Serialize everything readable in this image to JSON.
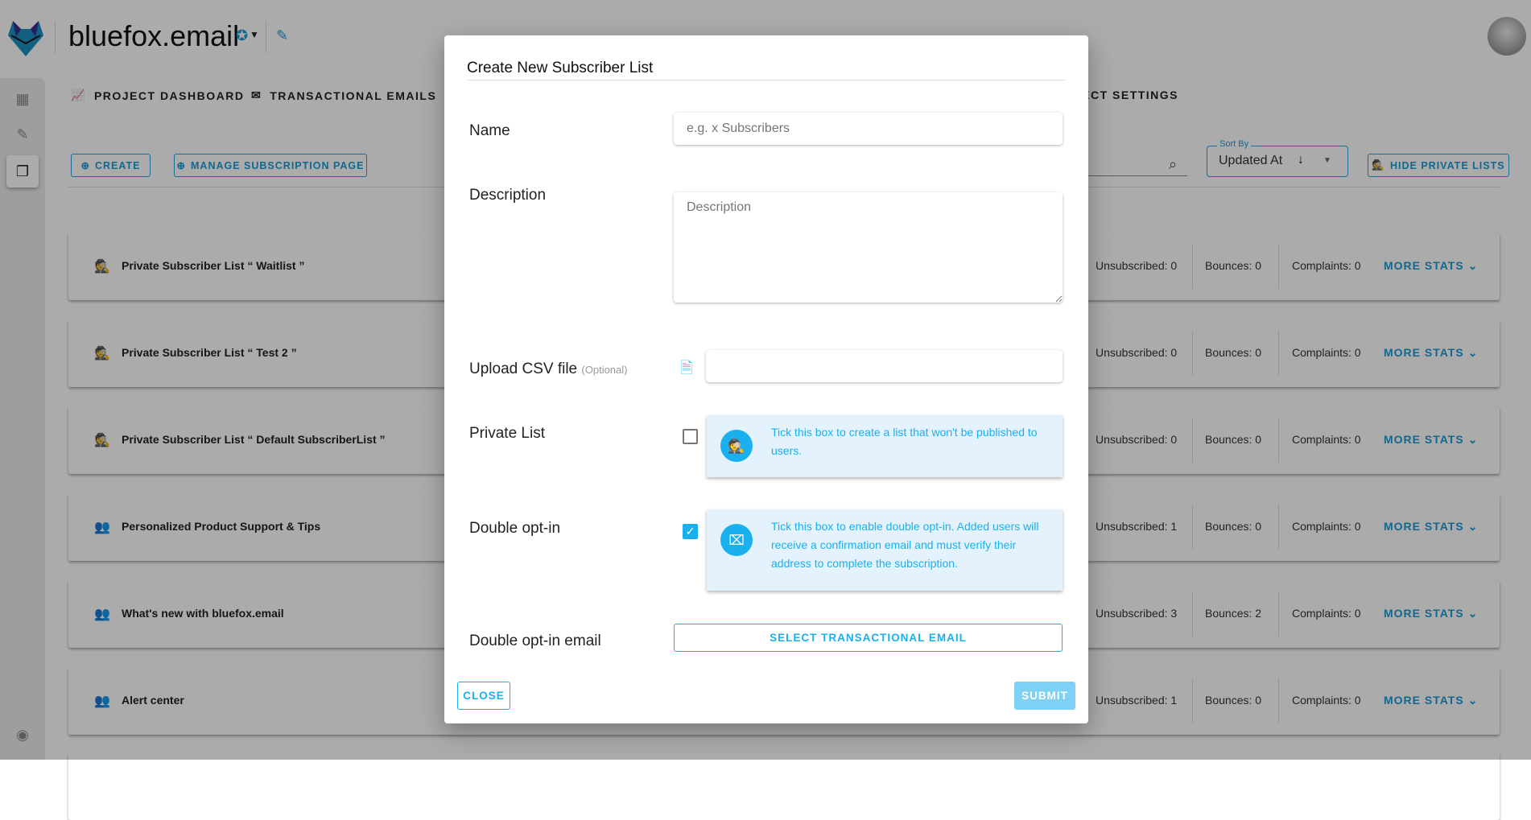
{
  "app": {
    "title": "bluefox.email",
    "accent": "#1ab0ee"
  },
  "nav": [
    {
      "label": "PROJECT DASHBOARD",
      "icon": "chart-icon"
    },
    {
      "label": "TRANSACTIONAL EMAILS",
      "icon": "email-fast-icon"
    },
    {
      "label": "PROJECT SETTINGS",
      "icon": "settings-icon"
    }
  ],
  "toolbar": {
    "create": "CREATE",
    "manage": "MANAGE SUBSCRIPTION PAGE",
    "sort_label": "Sort By",
    "sort_value": "Updated At",
    "hide_private": "HIDE PRIVATE LISTS"
  },
  "lists": [
    {
      "name": "Private Subscriber List “ Waitlist ”",
      "private": true,
      "unsubscribed": "Unsubscribed: 0",
      "bounces": "Bounces: 0",
      "complaints": "Complaints: 0"
    },
    {
      "name": "Private Subscriber List “ Test 2 ”",
      "private": true,
      "unsubscribed": "Unsubscribed: 0",
      "bounces": "Bounces: 0",
      "complaints": "Complaints: 0"
    },
    {
      "name": "Private Subscriber List “ Default SubscriberList ”",
      "private": true,
      "unsubscribed": "Unsubscribed: 0",
      "bounces": "Bounces: 0",
      "complaints": "Complaints: 0"
    },
    {
      "name": "Personalized Product Support & Tips",
      "private": false,
      "unsubscribed": "Unsubscribed: 1",
      "bounces": "Bounces: 0",
      "complaints": "Complaints: 0"
    },
    {
      "name": "What's new with bluefox.email",
      "private": false,
      "unsubscribed": "Unsubscribed: 3",
      "bounces": "Bounces: 2",
      "complaints": "Complaints: 0"
    },
    {
      "name": "Alert center",
      "private": false,
      "unsubscribed": "Unsubscribed: 1",
      "bounces": "Bounces: 0",
      "complaints": "Complaints: 0"
    }
  ],
  "more_stats": "MORE STATS",
  "modal": {
    "title": "Create New Subscriber List",
    "name_label": "Name",
    "name_placeholder": "e.g. x Subscribers",
    "desc_label": "Description",
    "desc_placeholder": "Description",
    "csv_label": "Upload CSV file",
    "csv_optional": "(Optional)",
    "private_label": "Private List",
    "private_checked": false,
    "private_info": "Tick this box to create a list that won't be published to users.",
    "double_label": "Double opt-in",
    "double_checked": true,
    "double_info": "Tick this box to enable double opt-in. Added users will receive a confirmation email and must verify their address to complete the subscription.",
    "double_email_label": "Double opt-in email",
    "select_email": "SELECT TRANSACTIONAL EMAIL",
    "close": "CLOSE",
    "submit": "SUBMIT"
  }
}
